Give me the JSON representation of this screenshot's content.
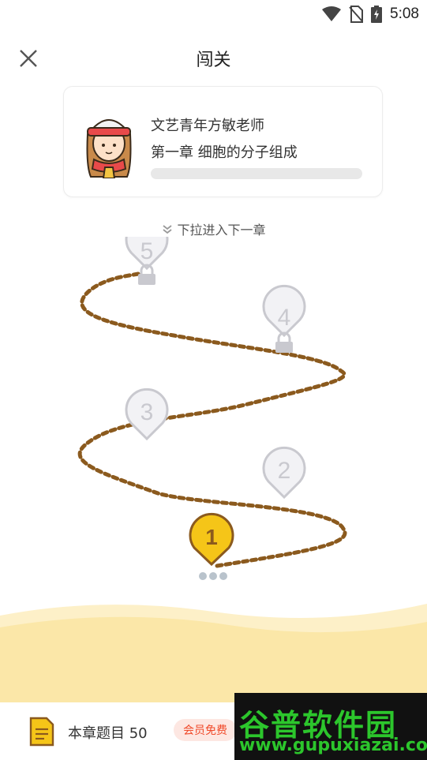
{
  "status_bar": {
    "time": "5:08",
    "icons": [
      "wifi-icon",
      "no-sim-icon",
      "battery-charging-icon"
    ]
  },
  "header": {
    "title": "闯关",
    "close_icon": "close-icon"
  },
  "chapter_card": {
    "teacher": "文艺青年方敏老师",
    "chapter": "第一章 细胞的分子组成",
    "progress": 0
  },
  "pull_hint": "下拉进入下一章",
  "levels": [
    {
      "number": "1",
      "state": "current"
    },
    {
      "number": "2",
      "state": "unlocked"
    },
    {
      "number": "3",
      "state": "unlocked"
    },
    {
      "number": "4",
      "state": "locked"
    },
    {
      "number": "5",
      "state": "locked"
    }
  ],
  "bottom_bar": {
    "question_count": "本章题目 50",
    "vip_label": "会员免费"
  },
  "watermark": {
    "line1": "谷普软件园",
    "line2": "www.gupuxiazai.com"
  },
  "colors": {
    "accent": "#f5b800",
    "path": "#8b5a1e",
    "locked": "#c9c9cf",
    "vip": "#f04a2a",
    "sand": "#fbe7a8"
  }
}
